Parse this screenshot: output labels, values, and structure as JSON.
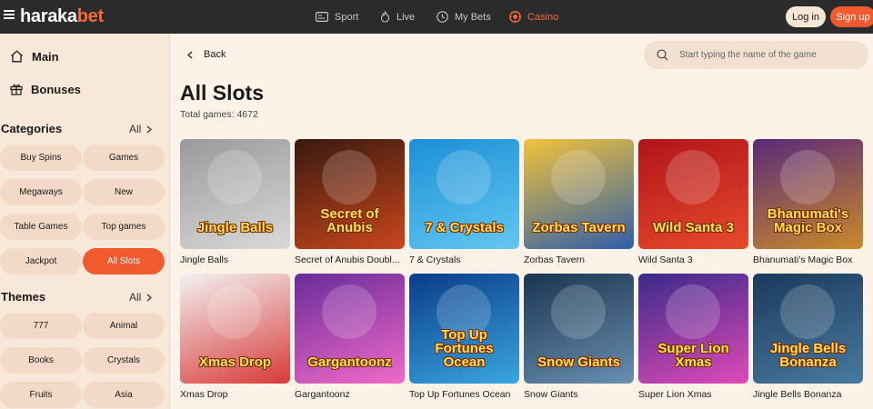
{
  "header": {
    "logo_part1": "haraka",
    "logo_part2": "bet",
    "nav": [
      {
        "label": "Sport",
        "icon": "sport-icon"
      },
      {
        "label": "Live",
        "icon": "fire-icon"
      },
      {
        "label": "My Bets",
        "icon": "clock-icon"
      },
      {
        "label": "Casino",
        "icon": "casino-chip-icon"
      }
    ],
    "login_label": "Log in",
    "signup_label": "Sign up"
  },
  "sidebar": {
    "main_label": "Main",
    "bonuses_label": "Bonuses",
    "categories_title": "Categories",
    "categories_all": "All",
    "categories": [
      "Buy Spins",
      "Games",
      "Megaways",
      "New",
      "Table Games",
      "Top games",
      "Jackpot",
      "All Slots"
    ],
    "active_category": "All Slots",
    "themes_title": "Themes",
    "themes_all": "All",
    "themes": [
      "777",
      "Animal",
      "Books",
      "Crystals",
      "Fruits",
      "Asia"
    ]
  },
  "main": {
    "back_label": "Back",
    "search_placeholder": "Start typing the name of the game",
    "title": "All Slots",
    "total_games": "Total games: 4672",
    "games": [
      {
        "name": "Jingle Balls",
        "art": "Jingle Balls",
        "colors": [
          "#9a9a9a",
          "#d9d9d9"
        ]
      },
      {
        "name": "Secret of Anubis Doubl...",
        "art": "Secret of Anubis",
        "colors": [
          "#3a1a10",
          "#c8461c"
        ]
      },
      {
        "name": "7 & Crystals",
        "art": "7 & Crystals",
        "colors": [
          "#1b8fd6",
          "#63c8f0"
        ]
      },
      {
        "name": "Zorbas Tavern",
        "art": "Zorbas Tavern",
        "colors": [
          "#f3c23a",
          "#2f5fa8"
        ]
      },
      {
        "name": "Wild Santa 3",
        "art": "Wild Santa 3",
        "colors": [
          "#b0141a",
          "#e84a2c"
        ]
      },
      {
        "name": "Bhanumati's Magic Box",
        "art": "Bhanumati's Magic Box",
        "colors": [
          "#5a2a7a",
          "#c98a2a"
        ]
      },
      {
        "name": "Xmas Drop",
        "art": "Xmas Drop",
        "colors": [
          "#f2f2f2",
          "#d93a3a"
        ]
      },
      {
        "name": "Gargantoonz",
        "art": "Gargantoonz",
        "colors": [
          "#6a2c9a",
          "#f06ac8"
        ]
      },
      {
        "name": "Top Up Fortunes Ocean",
        "art": "Top Up Fortunes Ocean",
        "colors": [
          "#0a3c8a",
          "#3aa6e0"
        ]
      },
      {
        "name": "Snow Giants",
        "art": "Snow Giants",
        "colors": [
          "#1a3550",
          "#6a8fb0"
        ]
      },
      {
        "name": "Super Lion Xmas",
        "art": "Super Lion Xmas",
        "colors": [
          "#3a2a8a",
          "#e04ab8"
        ]
      },
      {
        "name": "Jingle Bells Bonanza",
        "art": "Jingle Bells Bonanza",
        "colors": [
          "#1a3a5a",
          "#4a7aa0"
        ]
      }
    ]
  }
}
